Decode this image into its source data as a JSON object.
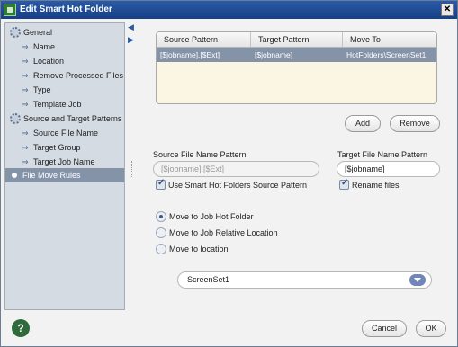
{
  "window": {
    "title": "Edit Smart Hot Folder",
    "close_symbol": "✕"
  },
  "tree": {
    "items": [
      {
        "label": "General",
        "level": 0,
        "icon": "gear-icon"
      },
      {
        "label": "Name",
        "level": 1
      },
      {
        "label": "Location",
        "level": 1
      },
      {
        "label": "Remove Processed Files",
        "level": 1
      },
      {
        "label": "Type",
        "level": 1
      },
      {
        "label": "Template Job",
        "level": 1
      },
      {
        "label": "Source and Target Patterns",
        "level": 0,
        "icon": "gear-icon"
      },
      {
        "label": "Source File Name",
        "level": 1
      },
      {
        "label": "Target Group",
        "level": 1
      },
      {
        "label": "Target Job Name",
        "level": 1
      },
      {
        "label": "File Move Rules",
        "level": 0,
        "selected": true
      }
    ],
    "arrow_glyph": "⇒"
  },
  "side_arrows": {
    "collapse": "◀",
    "expand": "▶"
  },
  "rules_table": {
    "columns": [
      "Source Pattern",
      "Target Pattern",
      "Move To"
    ],
    "rows": [
      [
        "[$jobname].[$Ext]",
        "[$jobname]",
        "HotFolders\\ScreenSet1"
      ]
    ]
  },
  "buttons": {
    "add": "Add",
    "remove": "Remove",
    "cancel": "Cancel",
    "ok": "OK",
    "help": "?"
  },
  "source_pattern": {
    "label": "Source File Name Pattern",
    "value": "[$jobname].[$Ext]",
    "use_smart_label": "Use Smart Hot Folders Source Pattern"
  },
  "target_pattern": {
    "label": "Target File Name Pattern",
    "value": "[$jobname]",
    "rename_label": "Rename files"
  },
  "move_options": {
    "options": [
      "Move to Job Hot Folder",
      "Move to Job Relative Location",
      "Move to location"
    ],
    "selected": "Move to Job Hot Folder"
  },
  "location_select": {
    "value": "ScreenSet1"
  },
  "colors": {
    "title_bar": "#1f4c98",
    "selection": "#8593a8",
    "table_bg": "#fbf6e4",
    "help": "#2f6b3a"
  }
}
